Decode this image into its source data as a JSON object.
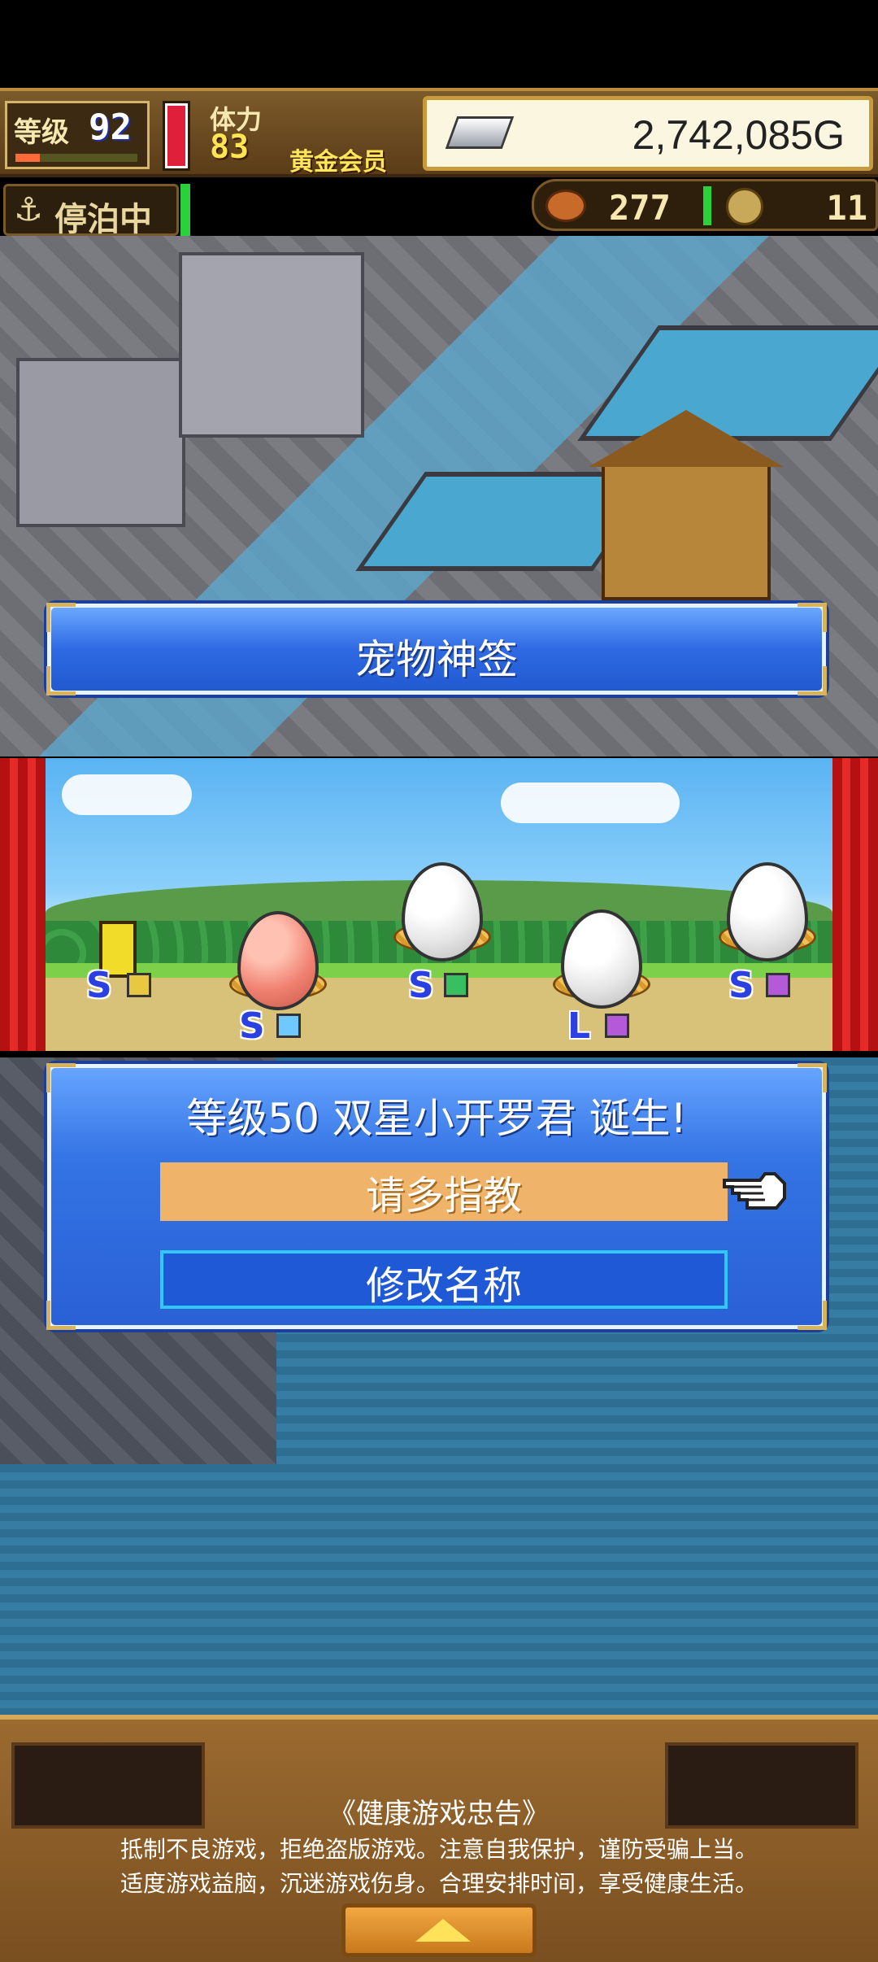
{
  "hud": {
    "level_label": "等级",
    "level": "92",
    "level_progress": 0.2,
    "stamina_label": "体力",
    "stamina": "83",
    "stamina_gauge": 1.0,
    "membership": "黄金会员",
    "gold": "2,742,085G",
    "anchor_status": "停泊中",
    "food": "277",
    "coins": "11"
  },
  "banner": {
    "title": "宠物神签"
  },
  "stage": {
    "pets": [
      {
        "rank": "S",
        "type": "robot",
        "gem_color": "#e8c840"
      },
      {
        "rank": "S",
        "type": "egg-pink",
        "gem_color": "#6fc8ff"
      },
      {
        "rank": "S",
        "type": "egg-white",
        "gem_color": "#38c060"
      },
      {
        "rank": "L",
        "type": "egg-white",
        "gem_color": "#b45ad8"
      },
      {
        "rank": "S",
        "type": "egg-white",
        "gem_color": "#b45ad8"
      }
    ]
  },
  "dialog": {
    "message": "等级50 双星小开罗君 诞生!",
    "confirm_label": "请多指教",
    "rename_label": "修改名称"
  },
  "footer": {
    "advisory_title": "《健康游戏忠告》",
    "advisory_line1": "抵制不良游戏，拒绝盗版游戏。注意自我保护，谨防受骗上当。",
    "advisory_line2": "适度游戏益脑，沉迷游戏伤身。合理安排时间，享受健康生活。"
  },
  "colors": {
    "accent_blue": "#2f6ae3",
    "confirm_orange": "#f0b36a",
    "curtain_red": "#e52a2a"
  }
}
